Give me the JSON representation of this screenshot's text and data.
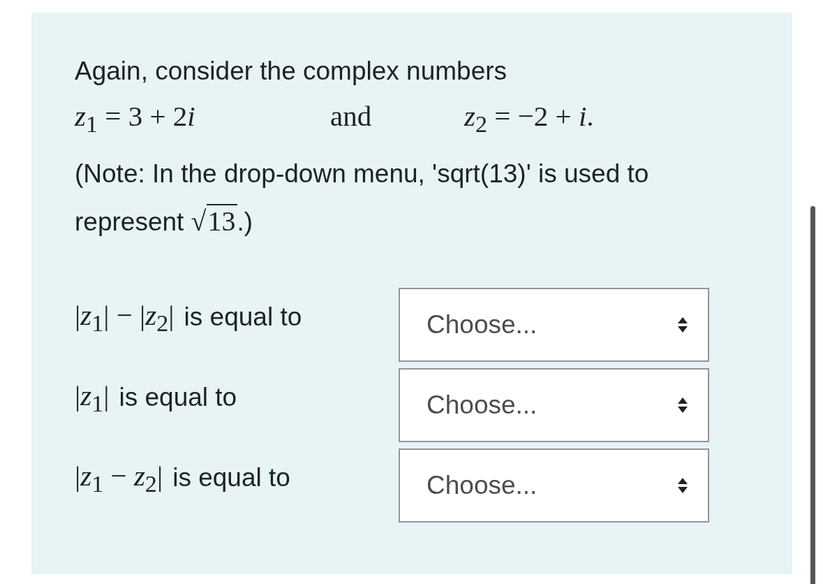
{
  "intro": "Again, consider the complex numbers",
  "equation": {
    "left": {
      "var": "z",
      "sub": "1",
      "rhs": "= 3 + 2",
      "imag": "i"
    },
    "connector": "and",
    "right": "*z*$_{2}$ = −2 + *i*."
  },
  "note": {
    "before": "(Note: In the drop-down menu, 'sqrt(13)' is used to represent ",
    "radical": "√",
    "radicand": "13",
    "after": ".)"
  },
  "questions": [
    {
      "math": "|*z*$_{1}$| − |*z*$_{2}$|",
      "text": "is equal to",
      "select": {
        "value": "Choose..."
      }
    },
    {
      "math": "|*z*$_{1}$|",
      "text": "is equal to",
      "select": {
        "value": "Choose..."
      }
    },
    {
      "math": "|*z*$_{1}$ − *z*$_{2}$|",
      "text": "is equal to",
      "select": {
        "value": "Choose..."
      }
    }
  ]
}
